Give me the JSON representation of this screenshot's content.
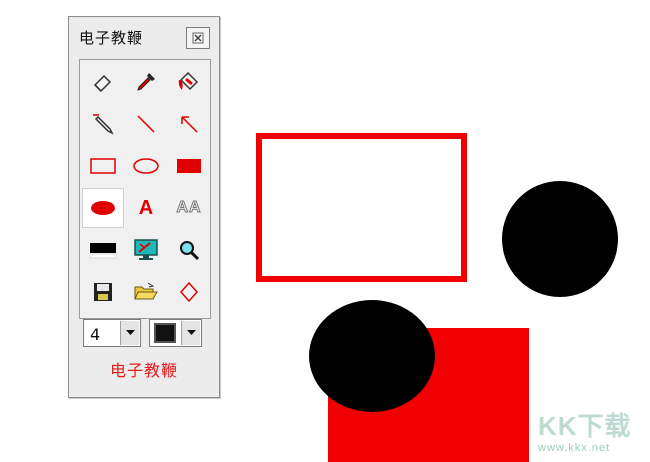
{
  "window": {
    "title": "电子教鞭",
    "footer_label": "电子教鞭"
  },
  "tools": [
    {
      "icon": "eraser-icon"
    },
    {
      "icon": "eyedropper-icon"
    },
    {
      "icon": "paint-bucket-icon"
    },
    {
      "icon": "pen-icon"
    },
    {
      "icon": "line-icon"
    },
    {
      "icon": "arrow-icon"
    },
    {
      "icon": "rectangle-outline-icon"
    },
    {
      "icon": "ellipse-outline-icon"
    },
    {
      "icon": "rectangle-filled-icon"
    },
    {
      "icon": "ellipse-filled-icon",
      "selected": true
    },
    {
      "icon": "text-icon",
      "text": "A"
    },
    {
      "icon": "text-outline-icon",
      "text": "AA"
    },
    {
      "icon": "black-bar-icon"
    },
    {
      "icon": "screen-icon"
    },
    {
      "icon": "magnifier-icon"
    },
    {
      "icon": "save-icon"
    },
    {
      "icon": "open-folder-icon"
    },
    {
      "icon": "diamond-icon"
    }
  ],
  "controls": {
    "size_value": "4",
    "color_value": "#111111"
  },
  "colors": {
    "accent_red": "#f00000",
    "shape_black": "#000000"
  },
  "watermark": {
    "logo": "KK下载",
    "url": "www.kkx.net"
  }
}
